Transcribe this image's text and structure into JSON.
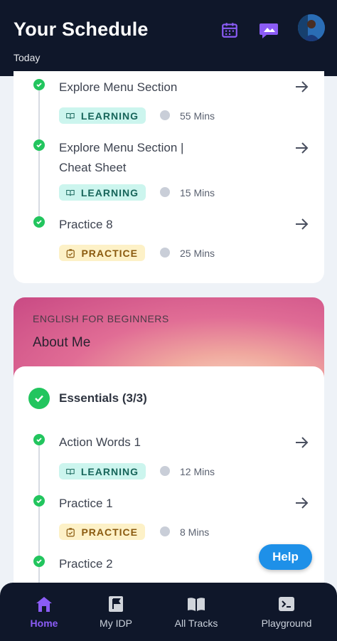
{
  "header": {
    "title": "Your Schedule",
    "subtitle": "Today"
  },
  "header_icons": [
    "calendar-icon",
    "chat-icon",
    "avatar"
  ],
  "first_list": [
    {
      "title": "Explore Menu Section",
      "type": "LEARNING",
      "duration": "55 Mins"
    },
    {
      "title_line1": "Explore Menu Section |",
      "title_line2": "Cheat Sheet",
      "type": "LEARNING",
      "duration": "15 Mins"
    },
    {
      "title": "Practice 8",
      "type": "PRACTICE",
      "duration": "25 Mins"
    }
  ],
  "course": {
    "label": "ENGLISH FOR BEGINNERS",
    "name": "About Me"
  },
  "section": {
    "title": "Essentials (3/3)"
  },
  "second_list": [
    {
      "title": "Action Words 1",
      "type": "LEARNING",
      "duration": "12 Mins"
    },
    {
      "title": "Practice 1",
      "type": "PRACTICE",
      "duration": "8 Mins"
    },
    {
      "title": "Practice 2"
    }
  ],
  "help": {
    "label": "Help"
  },
  "nav": [
    {
      "label": "Home",
      "icon": "home-icon",
      "active": true
    },
    {
      "label": "My IDP",
      "icon": "flag-icon"
    },
    {
      "label": "All Tracks",
      "icon": "book-icon"
    },
    {
      "label": "Playground",
      "icon": "terminal-icon"
    }
  ],
  "colors": {
    "header_bg": "#0f172a",
    "accent": "#8b5cf6",
    "check": "#22c55e",
    "learning_bg": "#ccf5ee",
    "practice_bg": "#fdf1c7",
    "help": "#1e90e8"
  }
}
